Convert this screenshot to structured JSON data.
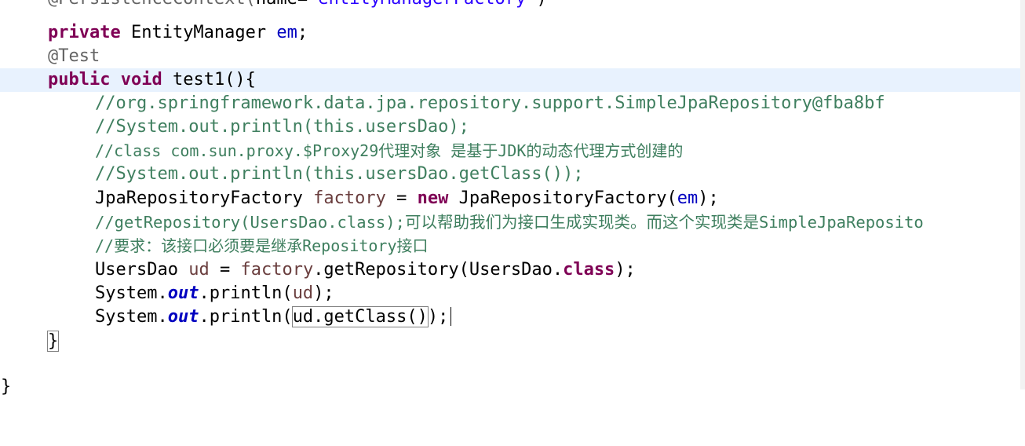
{
  "editor": {
    "lines": [
      {
        "parts": [
          "@PersistenceContext(",
          "name=",
          "\"entityManagerFactory\"",
          ")"
        ]
      },
      {
        "parts": [
          "private",
          " EntityManager ",
          "em",
          ";"
        ]
      },
      {
        "parts": [
          "@Test"
        ]
      },
      {
        "parts": [
          "public",
          " ",
          "void",
          " test1(){"
        ]
      },
      {
        "parts": [
          "//org.springframework.data.jpa.repository.support.SimpleJpaRepository@fba8bf"
        ]
      },
      {
        "parts": [
          "//System.out.println(this.usersDao);"
        ]
      },
      {
        "parts": [
          "//class com.sun.proxy.$Proxy29代理对象 是基于JDK的动态代理方式创建的"
        ]
      },
      {
        "parts": [
          "//System.out.println(this.usersDao.getClass());"
        ]
      },
      {
        "parts": [
          "JpaRepositoryFactory ",
          "factory",
          " = ",
          "new",
          " JpaRepositoryFactory(",
          "em",
          ");"
        ]
      },
      {
        "parts": [
          "//getRepository(UsersDao.class);可以帮助我们为接口生成实现类。而这个实现类是SimpleJpaReposito"
        ]
      },
      {
        "parts": [
          "//要求：该接口必须要是继承Repository接口"
        ]
      },
      {
        "parts": [
          "UsersDao ",
          "ud",
          " = ",
          "factory",
          ".getRepository(UsersDao.",
          "class",
          ");"
        ]
      },
      {
        "parts": [
          "System.",
          "out",
          ".println(",
          "ud",
          ");"
        ]
      },
      {
        "parts": [
          "System.",
          "out",
          ".println(",
          "ud.getClass()",
          ");"
        ]
      },
      {
        "parts": [
          "}"
        ]
      },
      {
        "parts": [
          "}"
        ]
      }
    ]
  }
}
